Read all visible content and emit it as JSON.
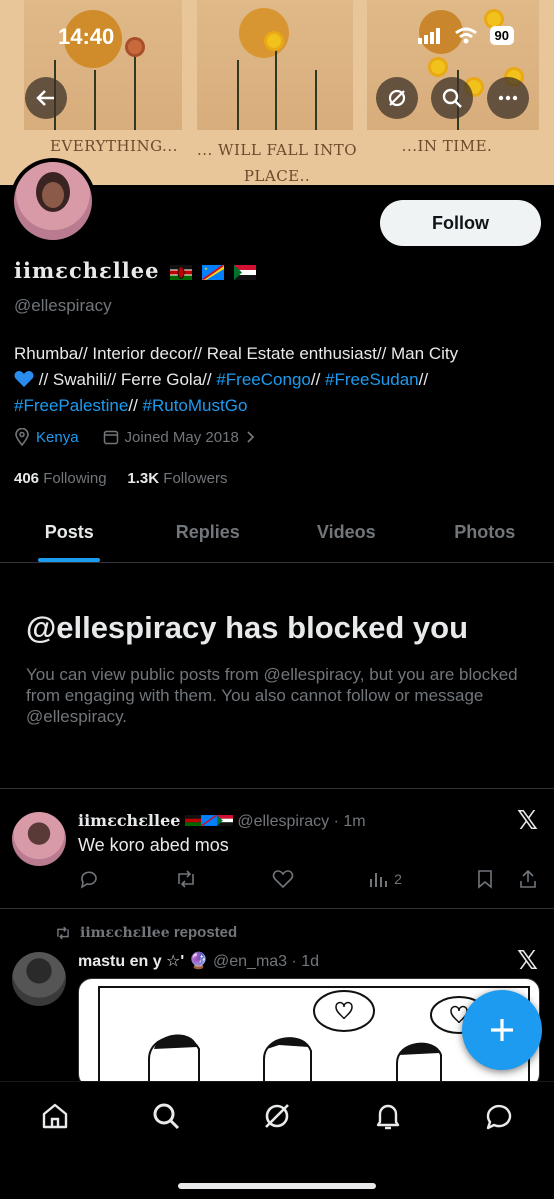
{
  "status_bar": {
    "time": "14:40",
    "battery": "90"
  },
  "banner": {
    "captions": [
      "EVERYTHING...",
      "... WILL FALL INTO PLACE..",
      "...IN TIME."
    ]
  },
  "profile": {
    "display_name": "iimɛchɛllee",
    "flags": [
      "kenya-flag",
      "drc-flag",
      "sudan-flag"
    ],
    "handle": "@ellespiracy",
    "follow_label": "Follow",
    "bio_parts": {
      "a": "Rhumba// Interior decor// Real Estate enthusiast// Man City",
      "b": " // Swahili// Ferre Gola// ",
      "tag1": "#FreeCongo",
      "c": "// ",
      "tag2": "#FreeSudan",
      "d": "//",
      "tag3": "#FreePalestine",
      "e": "// ",
      "tag4": "#RutoMustGo"
    },
    "location": "Kenya",
    "joined": "Joined May 2018",
    "following_count": "406",
    "following_label": "Following",
    "followers_count": "1.3K",
    "followers_label": "Followers"
  },
  "tabs": [
    {
      "label": "Posts",
      "active": true
    },
    {
      "label": "Replies",
      "active": false
    },
    {
      "label": "Videos",
      "active": false
    },
    {
      "label": "Photos",
      "active": false
    }
  ],
  "blocked_notice": {
    "title": "@ellespiracy has blocked you",
    "body": "You can view public posts from @ellespiracy, but you are blocked from engaging with them. You also cannot follow or message @ellespiracy."
  },
  "posts": [
    {
      "author": "iimɛchɛllee",
      "handle": "@ellespiracy · 1m",
      "text": "We koro abed mos",
      "views": "2"
    },
    {
      "reposted_by": "iimɛchɛllee",
      "reposted_label": "reposted",
      "author": "mastu en y ☆' 🔮",
      "handle": "@en_ma3 · 1d"
    }
  ],
  "colors": {
    "accent": "#1d9bf0",
    "text": "#e7e9ea",
    "muted": "#71767b",
    "bg": "#000000"
  }
}
